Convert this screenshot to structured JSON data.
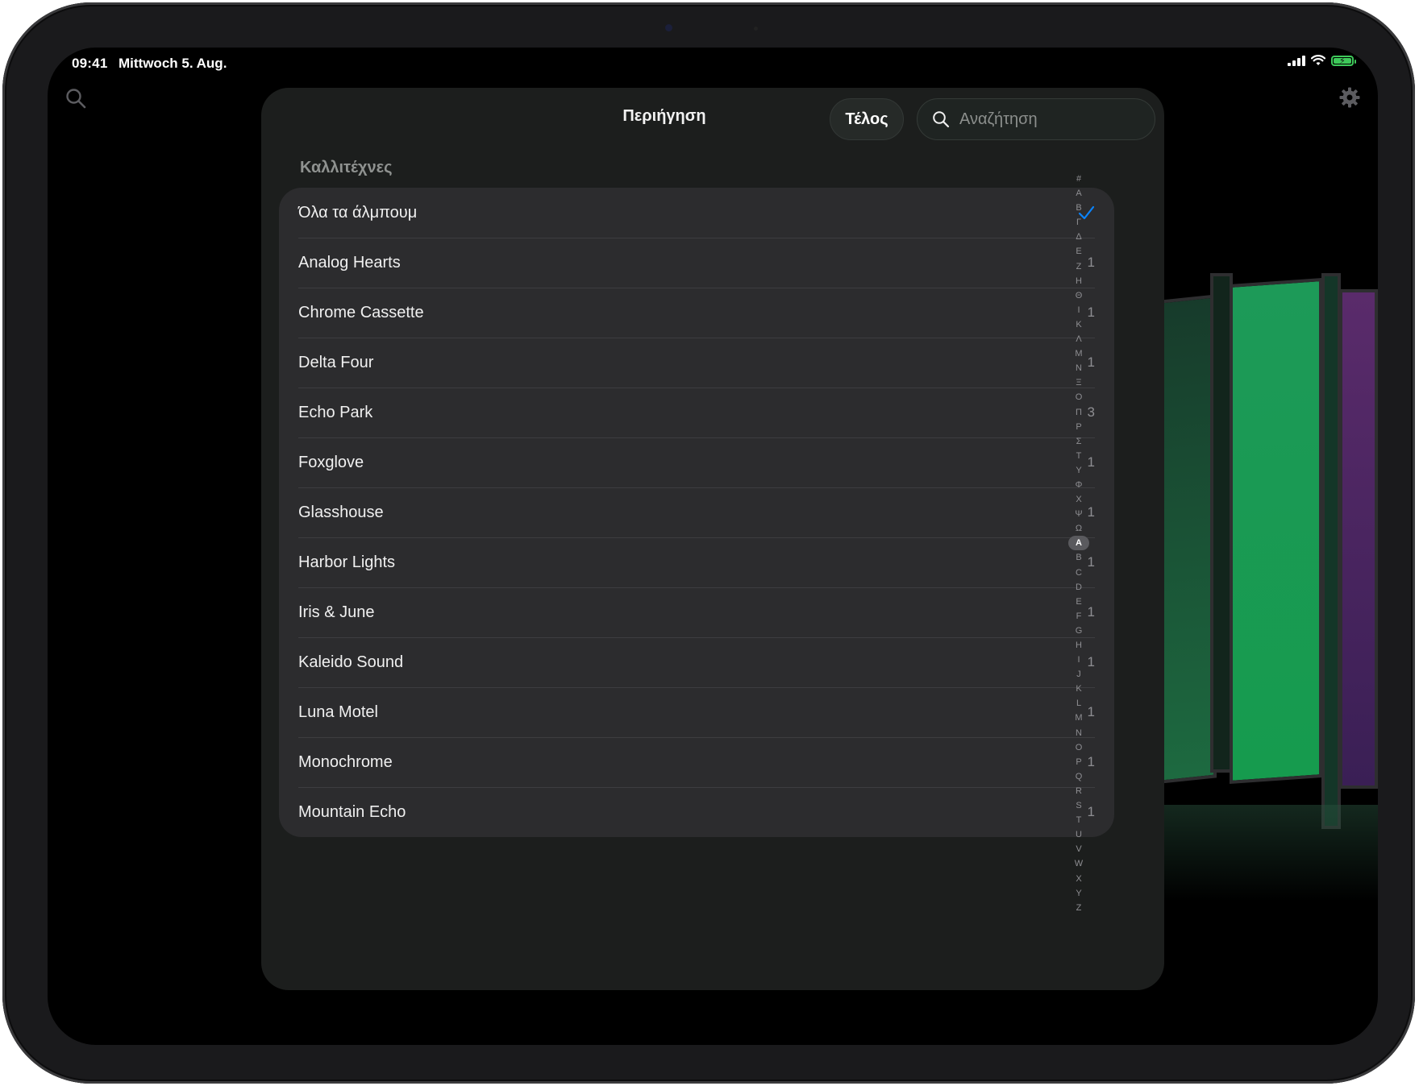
{
  "status_bar": {
    "time": "09:41",
    "date": "Mittwoch 5. Aug."
  },
  "browse_sheet": {
    "title": "Περιήγηση",
    "done_label": "Τέλος",
    "search_placeholder": "Αναζήτηση",
    "section_header": "Καλλιτέχνες",
    "items": [
      {
        "name": "Όλα τα άλμπουμ",
        "count": "",
        "selected": true
      },
      {
        "name": "Analog Hearts",
        "count": "1"
      },
      {
        "name": "Chrome Cassette",
        "count": "1"
      },
      {
        "name": "Delta Four",
        "count": "1"
      },
      {
        "name": "Echo Park",
        "count": "3"
      },
      {
        "name": "Foxglove",
        "count": "1"
      },
      {
        "name": "Glasshouse",
        "count": "1"
      },
      {
        "name": "Harbor Lights",
        "count": "1"
      },
      {
        "name": "Iris & June",
        "count": "1"
      },
      {
        "name": "Kaleido Sound",
        "count": "1"
      },
      {
        "name": "Luna Motel",
        "count": "1"
      },
      {
        "name": "Monochrome",
        "count": "1"
      },
      {
        "name": "Mountain Echo",
        "count": "1"
      }
    ],
    "index_letters": [
      "#",
      "Α",
      "Β",
      "Γ",
      "Δ",
      "Ε",
      "Ζ",
      "Η",
      "Θ",
      "Ι",
      "Κ",
      "Λ",
      "Μ",
      "Ν",
      "Ξ",
      "Ο",
      "Π",
      "Ρ",
      "Σ",
      "Τ",
      "Υ",
      "Φ",
      "Χ",
      "Ψ",
      "Ω",
      "A",
      "B",
      "C",
      "D",
      "E",
      "F",
      "G",
      "H",
      "I",
      "J",
      "K",
      "L",
      "M",
      "N",
      "O",
      "P",
      "Q",
      "R",
      "S",
      "T",
      "U",
      "V",
      "W",
      "X",
      "Y",
      "Z"
    ],
    "index_active": "A"
  },
  "colors": {
    "accent": "#0a84ff",
    "sheet_bg": "#1c1e1d",
    "list_bg": "#2c2c2e",
    "album_green": "#1f8a4c"
  }
}
